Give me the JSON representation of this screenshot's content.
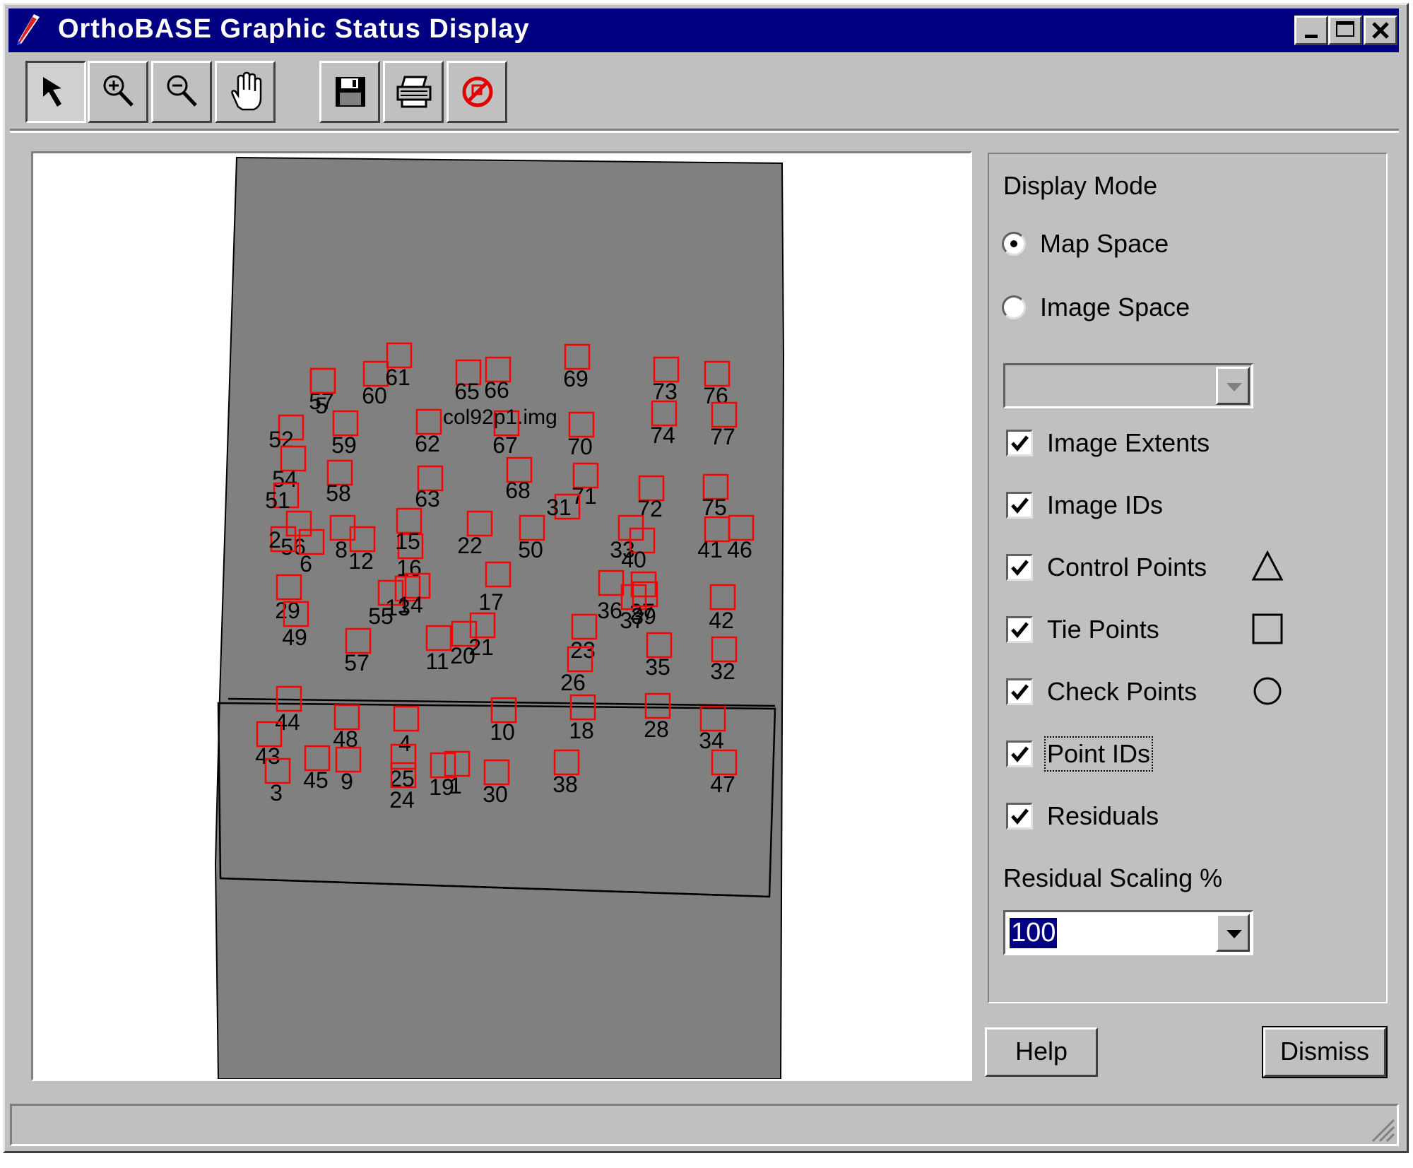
{
  "window": {
    "title": "OrthoBASE Graphic Status Display"
  },
  "titlebar_buttons": {
    "minimize": "_",
    "maximize": "□",
    "close": "X"
  },
  "toolbar": [
    {
      "name": "select-tool-button",
      "icon": "arrow-pointer-icon"
    },
    {
      "name": "zoom-in-button",
      "icon": "zoom-in-icon"
    },
    {
      "name": "zoom-out-button",
      "icon": "zoom-out-icon"
    },
    {
      "name": "pan-button",
      "icon": "hand-icon"
    },
    {
      "name": "save-button",
      "icon": "floppy-disk-icon"
    },
    {
      "name": "print-button",
      "icon": "printer-icon"
    },
    {
      "name": "clear-button",
      "icon": "no-symbol-icon"
    }
  ],
  "canvas": {
    "image_label": "col92p1.img",
    "tie_point_color": "#ff0000",
    "image_fill": "#808080",
    "points": [
      "57",
      "60",
      "61",
      "65",
      "66",
      "69",
      "73",
      "76",
      "62",
      "59",
      "67",
      "70",
      "74",
      "77",
      "52",
      "54",
      "58",
      "63",
      "68",
      "71",
      "72",
      "75",
      "51",
      "56",
      "2",
      "6",
      "8",
      "12",
      "16",
      "15",
      "22",
      "31",
      "33",
      "40",
      "41",
      "46",
      "50",
      "29",
      "55",
      "13",
      "14",
      "17",
      "27",
      "36",
      "37",
      "39",
      "42",
      "49",
      "57",
      "11",
      "20",
      "21",
      "23",
      "26",
      "35",
      "32",
      "44",
      "48",
      "4",
      "10",
      "18",
      "28",
      "34",
      "43",
      "45",
      "1",
      "9",
      "19",
      "25",
      "24",
      "30",
      "38",
      "47",
      "3",
      "5"
    ]
  },
  "panel": {
    "display_mode_label": "Display Mode",
    "map_space": "Map Space",
    "image_space": "Image Space",
    "image_select_value": "",
    "checks": [
      {
        "label": "Image Extents",
        "checked": true,
        "symbol": ""
      },
      {
        "label": "Image IDs",
        "checked": true,
        "symbol": ""
      },
      {
        "label": "Control Points",
        "checked": true,
        "symbol": "triangle-icon"
      },
      {
        "label": "Tie Points",
        "checked": true,
        "symbol": "square-icon"
      },
      {
        "label": "Check Points",
        "checked": true,
        "symbol": "circle-icon"
      },
      {
        "label": "Point IDs",
        "checked": true,
        "symbol": ""
      },
      {
        "label": "Residuals",
        "checked": true,
        "symbol": ""
      }
    ],
    "residual_scaling_label": "Residual Scaling %",
    "residual_scaling_value": "100"
  },
  "buttons": {
    "help": "Help",
    "dismiss": "Dismiss"
  }
}
